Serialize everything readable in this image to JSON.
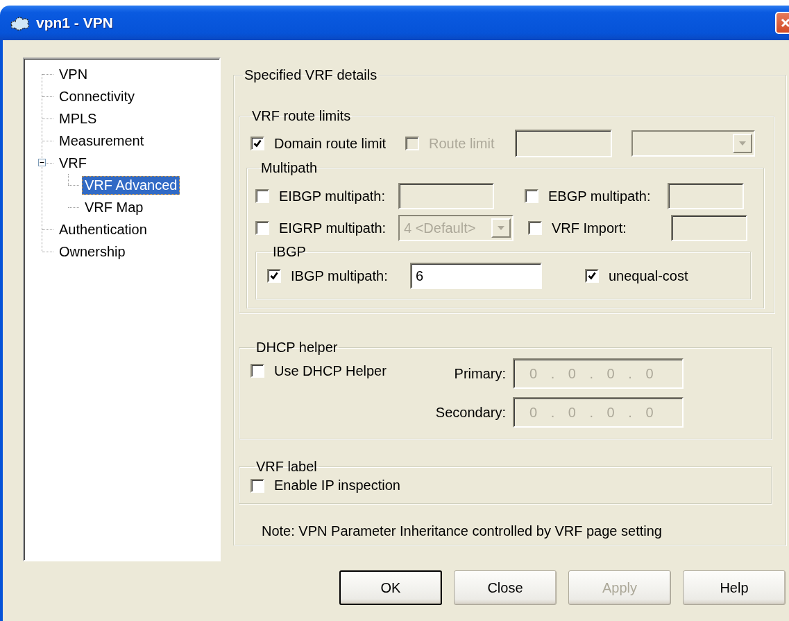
{
  "window": {
    "title": "vpn1 - VPN"
  },
  "tree": [
    {
      "label": "VPN",
      "selected": false
    },
    {
      "label": "Connectivity",
      "selected": false
    },
    {
      "label": "MPLS",
      "selected": false
    },
    {
      "label": "Measurement",
      "selected": false
    },
    {
      "label": "VRF",
      "selected": false,
      "expanded": true,
      "children": [
        {
          "label": "VRF Advanced",
          "selected": true
        },
        {
          "label": "VRF Map",
          "selected": false
        }
      ]
    },
    {
      "label": "Authentication",
      "selected": false
    },
    {
      "label": "Ownership",
      "selected": false
    }
  ],
  "details": {
    "title": "Specified VRF details",
    "route_limits": {
      "title": "VRF route limits",
      "domain_route_limit": {
        "label": "Domain route limit",
        "checked": true,
        "disabled": false
      },
      "route_limit": {
        "label": "Route limit",
        "checked": false,
        "disabled": true
      }
    },
    "multipath": {
      "title": "Multipath",
      "eibgp": {
        "label": "EIBGP multipath:",
        "checked": false
      },
      "ebgp": {
        "label": "EBGP multipath:",
        "checked": false
      },
      "eigrp": {
        "label": "EIGRP multipath:",
        "checked": false,
        "value": "4 <Default>"
      },
      "vrf_import": {
        "label": "VRF Import:",
        "checked": false
      },
      "ibgp": {
        "title": "IBGP",
        "multipath": {
          "label": "IBGP multipath:",
          "checked": true,
          "value": "6"
        },
        "unequal_cost": {
          "label": "unequal-cost",
          "checked": true
        }
      }
    },
    "dhcp": {
      "title": "DHCP helper",
      "use": {
        "label": "Use DHCP Helper",
        "checked": false
      },
      "primary": {
        "label": "Primary:",
        "value": "0 . 0 . 0 . 0",
        "disabled": true
      },
      "secondary": {
        "label": "Secondary:",
        "value": "0 . 0 . 0 . 0",
        "disabled": true
      }
    },
    "vrf_label": {
      "title": "VRF label",
      "inspection": {
        "label": "Enable IP inspection",
        "checked": false
      }
    },
    "note": "Note: VPN Parameter Inheritance controlled by VRF page setting"
  },
  "buttons": [
    {
      "label": "OK",
      "default": true,
      "disabled": false
    },
    {
      "label": "Close",
      "default": false,
      "disabled": false
    },
    {
      "label": "Apply",
      "default": false,
      "disabled": true
    },
    {
      "label": "Help",
      "default": false,
      "disabled": false
    }
  ]
}
